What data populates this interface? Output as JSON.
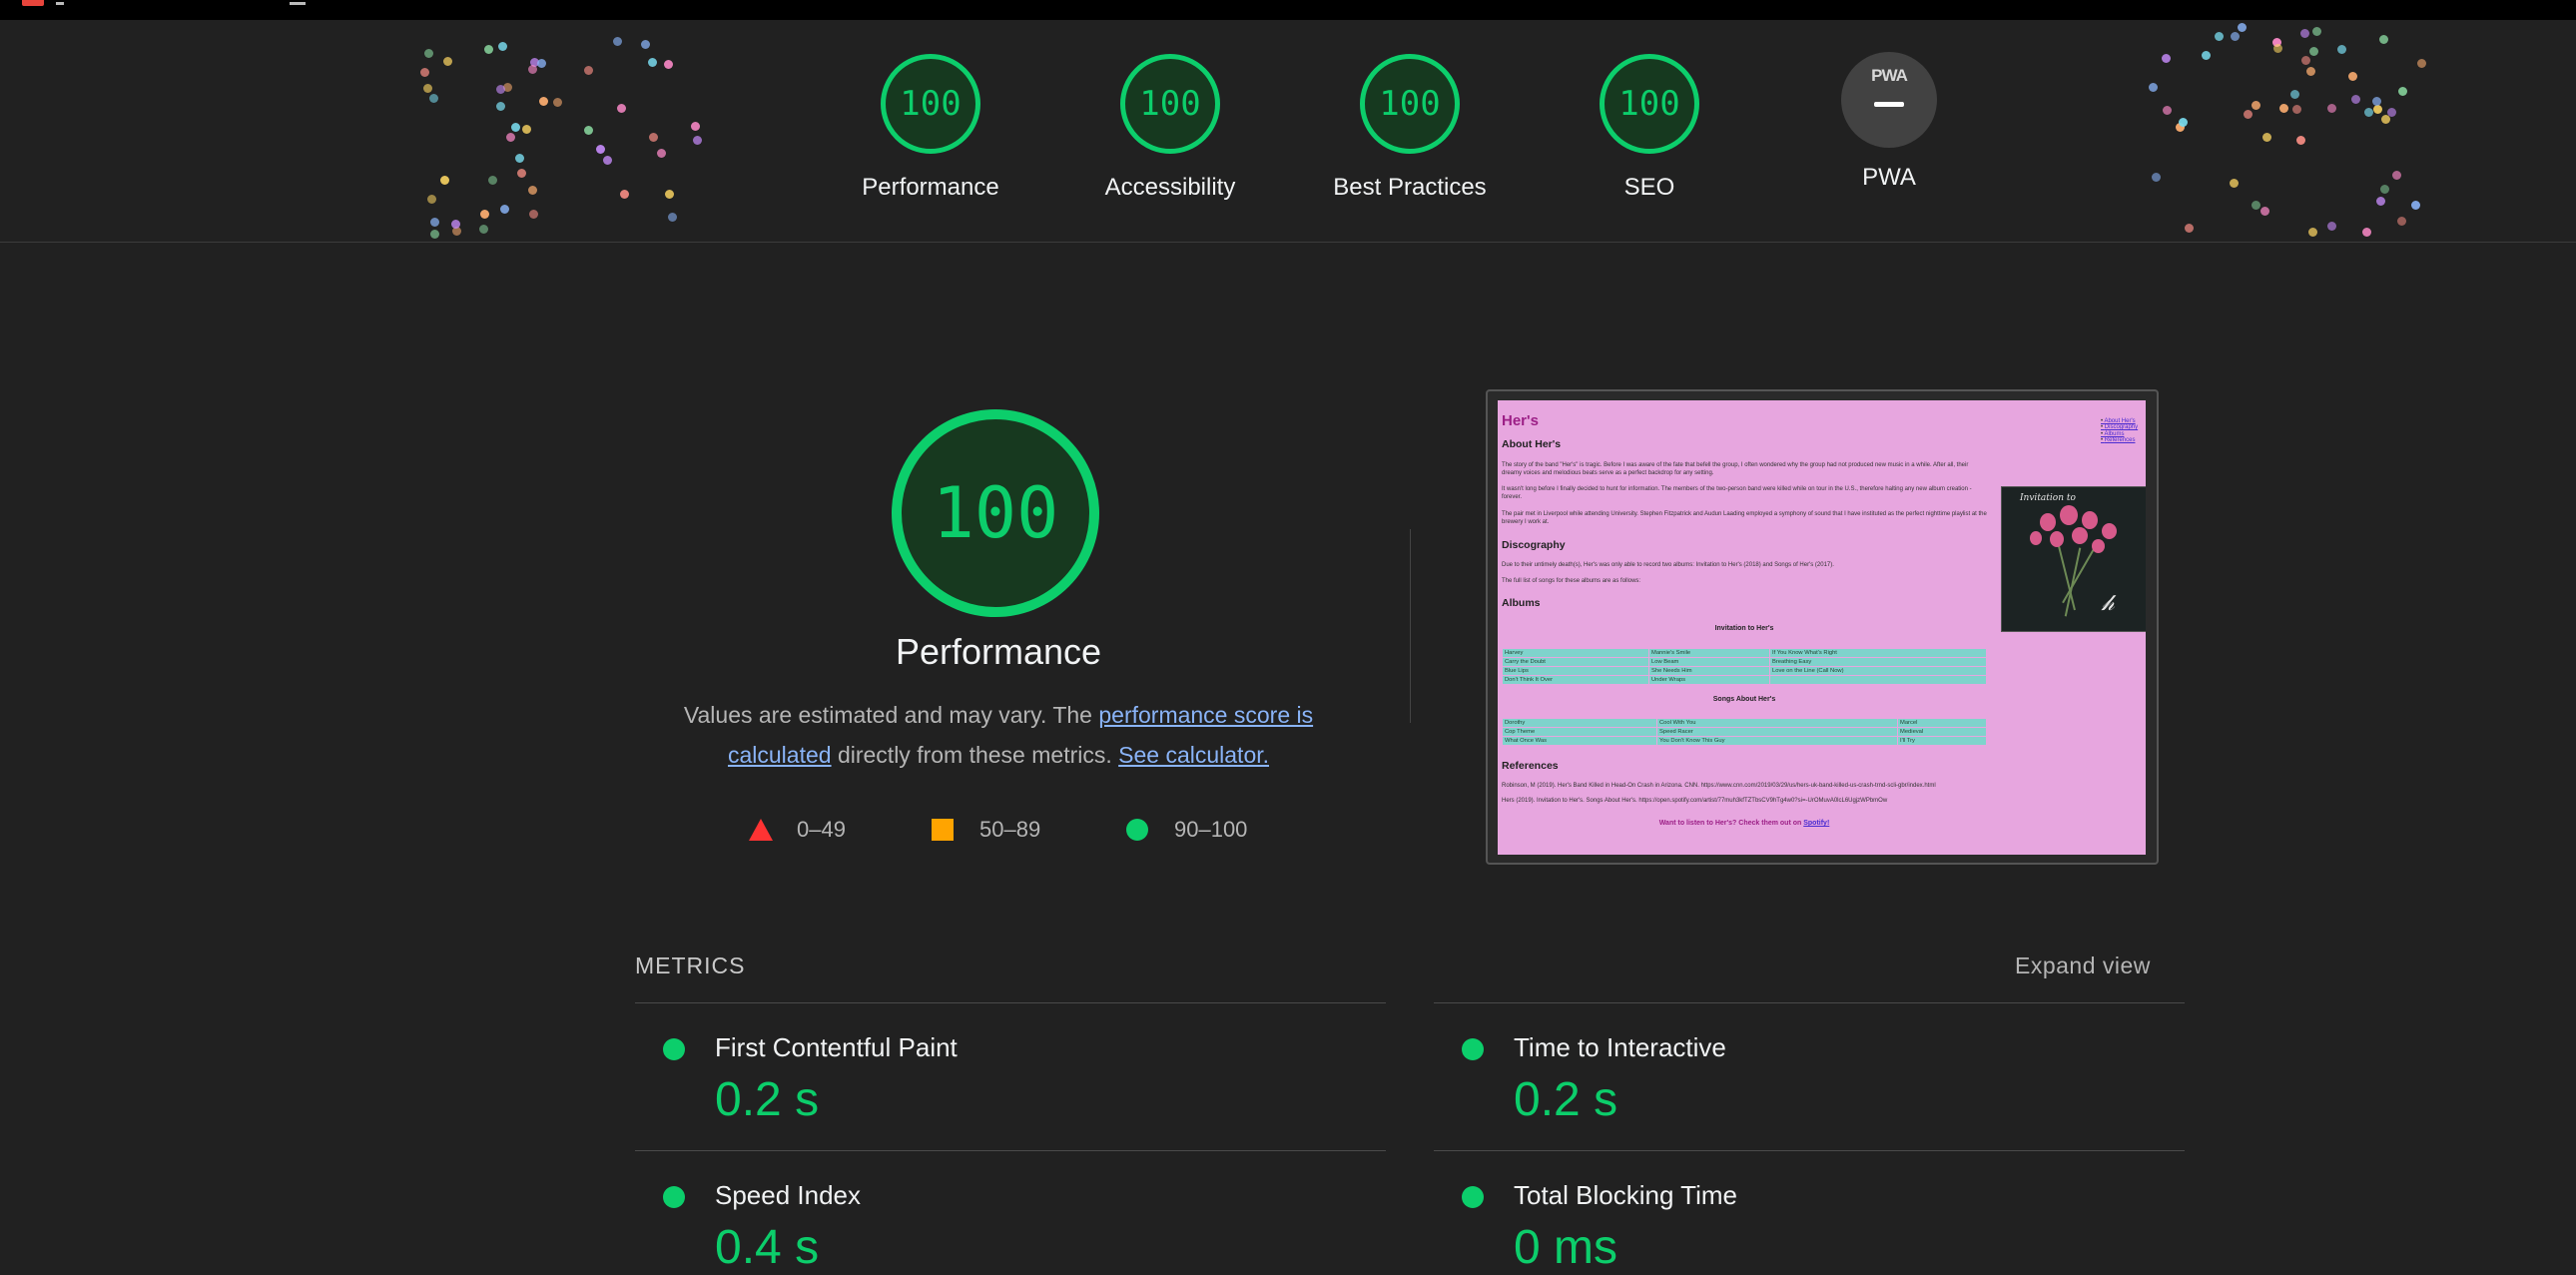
{
  "header": {
    "categories": [
      {
        "label": "Performance",
        "score": "100"
      },
      {
        "label": "Accessibility",
        "score": "100"
      },
      {
        "label": "Best Practices",
        "score": "100"
      },
      {
        "label": "SEO",
        "score": "100"
      }
    ],
    "pwa": {
      "badge": "PWA",
      "label": "PWA"
    }
  },
  "summary": {
    "score": "100",
    "title": "Performance",
    "desc_prefix": "Values are estimated and may vary. The ",
    "desc_link1": "performance score is calculated",
    "desc_middle": " directly from these metrics. ",
    "desc_link2": "See calculator.",
    "legend": {
      "fail": "0–49",
      "average": "50–89",
      "pass": "90–100"
    }
  },
  "screenshot": {
    "site_title": "Her's",
    "nav": [
      "About Her's",
      "Discography",
      "Albums",
      "References"
    ],
    "about_heading": "About Her's",
    "about_p1": "The story of the band \"Her's\" is tragic. Before I was aware of the fate that befell the group, I often wondered why the group had not produced new music in a while. After all, their dreamy voices and melodious beats serve as a perfect backdrop for any setting.",
    "about_p2": "It wasn't long before I finally decided to hunt for information. The members of the two-person band were killed while on tour in the U.S., therefore halting any new album creation - forever.",
    "about_p3": "The pair met in Liverpool while attending University. Stephen Fitzpatrick and Audun Laading employed a symphony of sound that I have instituted as the perfect nighttime playlist at the brewery I work at.",
    "disco_heading": "Discography",
    "disco_p1": "Due to their untimely death(s), Her's was only able to record two albums: Invitation to Her's (2018) and Songs of Her's (2017).",
    "disco_p2": "The full list of songs for these albums are as follows:",
    "albums_heading": "Albums",
    "album1_title": "Invitation to Her's",
    "album1_rows": [
      [
        "Harvey",
        "Mannie's Smile",
        "If You Know What's Right"
      ],
      [
        "Carry the Doubt",
        "Low Beam",
        "Breathing Easy"
      ],
      [
        "Blue Lips",
        "She Needs Him",
        "Love on the Line (Call Now)"
      ],
      [
        "Don't Think It Over",
        "Under Wraps",
        ""
      ]
    ],
    "album2_title": "Songs About Her's",
    "album2_rows": [
      [
        "Dorothy",
        "Cool With You",
        "Marcel"
      ],
      [
        "Cop Theme",
        "Speed Racer",
        "Medieval"
      ],
      [
        "What Once Was",
        "You Don't Know This Guy",
        "I'll Try"
      ]
    ],
    "refs_heading": "References",
    "ref1": "Robinson, M (2019). Her's Band Killed in Head-On Crash in Arizona. CNN. https://www.cnn.com/2019/03/29/us/hers-uk-band-killed-us-crash-trnd-scli-gbr/index.html",
    "ref2": "Hers (2019). Invitation to Her's. Songs About Her's. https://open.spotify.com/artist/77muh3kfTZTbsCV9hTg4w0?si=-UrOMuvA0lcL6UgjzWPbmOw",
    "listen_prefix": "Want to listen to Her's? Check them out on ",
    "listen_link": "Spotify!",
    "art_text": "Invitation to"
  },
  "metrics": {
    "title": "METRICS",
    "expand": "Expand view",
    "items": [
      {
        "name": "First Contentful Paint",
        "value": "0.2 s"
      },
      {
        "name": "Time to Interactive",
        "value": "0.2 s"
      },
      {
        "name": "Speed Index",
        "value": "0.4 s"
      },
      {
        "name": "Total Blocking Time",
        "value": "0 ms"
      }
    ]
  },
  "colors": {
    "pass": "#0cce6b",
    "average": "#ffa400",
    "fail": "#ff3333",
    "background": "#212121",
    "shot_bg": "#e7a6df",
    "table_cell": "#7fd3cc"
  }
}
